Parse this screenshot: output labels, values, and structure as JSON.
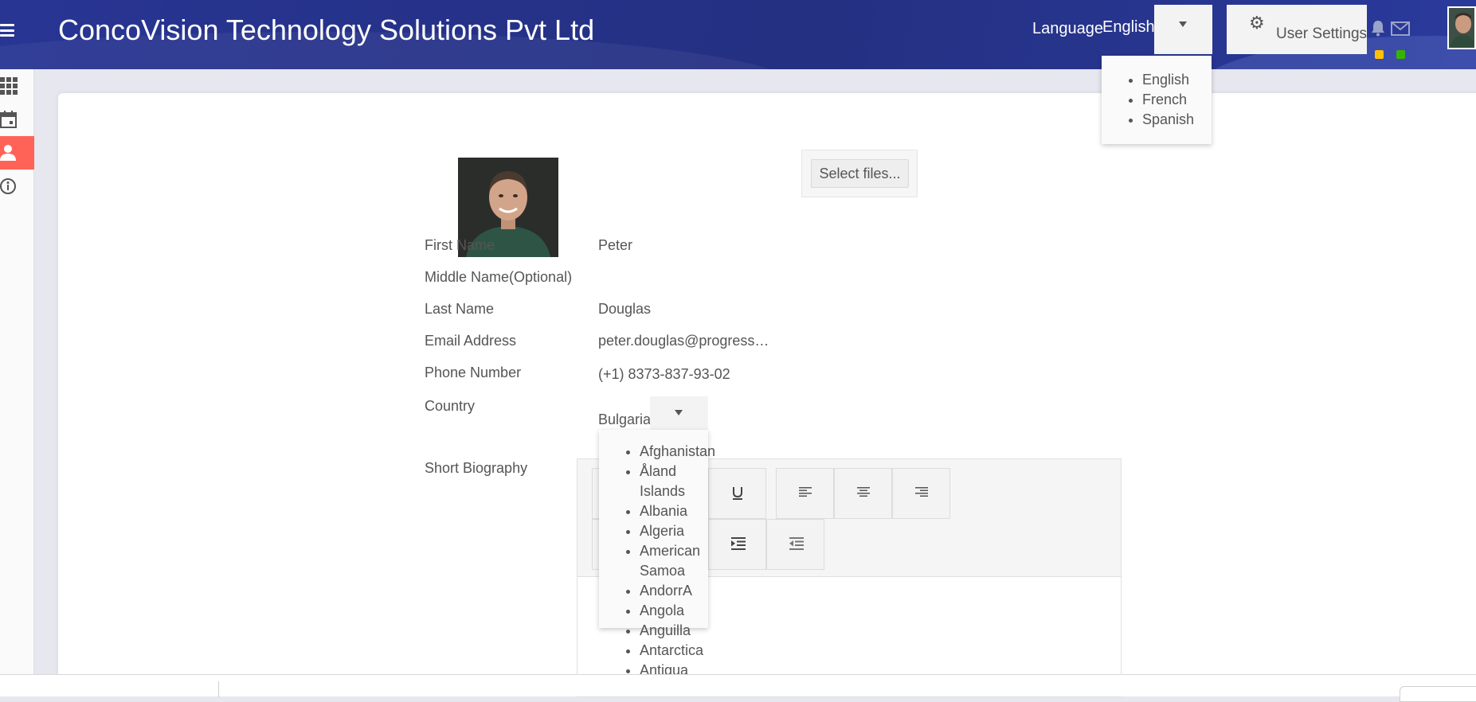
{
  "header": {
    "title": "ConcoVision Technology Solutions Pvt Ltd",
    "language_label": "Language",
    "language_value": "English",
    "user_settings_label": "User Settings",
    "colors": {
      "bar": "#283593",
      "notification_dot": "#ffc107",
      "mail_dot": "#37b400"
    }
  },
  "language_menu": {
    "options": [
      "English",
      "French",
      "Spanish"
    ]
  },
  "sidebar": {
    "items": [
      {
        "icon": "grid-icon",
        "active": false
      },
      {
        "icon": "calendar-icon",
        "active": false
      },
      {
        "icon": "user-icon",
        "active": true
      },
      {
        "icon": "info-icon",
        "active": false
      }
    ],
    "active_color": "#ff6358"
  },
  "profile": {
    "upload_label": "Select files...",
    "fields": {
      "first_name": {
        "label": "First Name",
        "value": "Peter"
      },
      "middle_name": {
        "label": "Middle Name(Optional)",
        "value": ""
      },
      "last_name": {
        "label": "Last Name",
        "value": "Douglas"
      },
      "email": {
        "label": "Email Address",
        "value": "peter.douglas@progress…"
      },
      "phone": {
        "label": "Phone Number",
        "value": "(+1) 8373-837-93-02"
      },
      "country": {
        "label": "Country",
        "value": "Bulgaria"
      },
      "biography": {
        "label": "Short Biography"
      }
    }
  },
  "country_menu": {
    "options": [
      "Afghanistan",
      "Åland Islands",
      "Albania",
      "Algeria",
      "American Samoa",
      "AndorrA",
      "Angola",
      "Anguilla",
      "Antarctica",
      "Antigua"
    ]
  }
}
